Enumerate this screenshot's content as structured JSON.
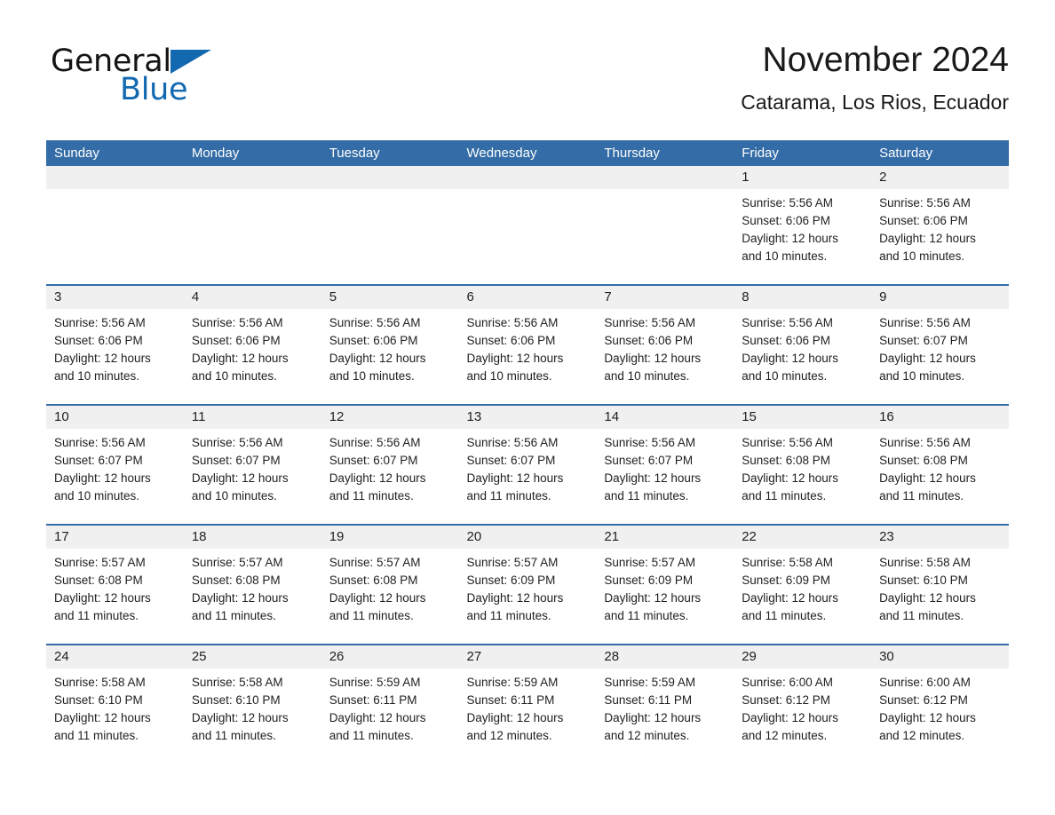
{
  "logo": {
    "word1": "General",
    "word2": "Blue",
    "triangle_color": "#1269b0",
    "text_color": "#141414"
  },
  "header": {
    "month_title": "November 2024",
    "location": "Catarama, Los Rios, Ecuador"
  },
  "colors": {
    "header_blue": "#336ca6",
    "daynum_gray": "#f0f0f0",
    "separator_blue": "#336ca6",
    "text": "#1f1f1f"
  },
  "weekdays": [
    "Sunday",
    "Monday",
    "Tuesday",
    "Wednesday",
    "Thursday",
    "Friday",
    "Saturday"
  ],
  "labels": {
    "sunrise_prefix": "Sunrise:",
    "sunset_prefix": "Sunset:",
    "daylight_prefix": "Daylight:"
  },
  "weeks": [
    [
      {
        "day": "",
        "empty": true
      },
      {
        "day": "",
        "empty": true
      },
      {
        "day": "",
        "empty": true
      },
      {
        "day": "",
        "empty": true
      },
      {
        "day": "",
        "empty": true
      },
      {
        "day": "1",
        "sunrise": "Sunrise: 5:56 AM",
        "sunset": "Sunset: 6:06 PM",
        "daylight_l1": "Daylight: 12 hours",
        "daylight_l2": "and 10 minutes."
      },
      {
        "day": "2",
        "sunrise": "Sunrise: 5:56 AM",
        "sunset": "Sunset: 6:06 PM",
        "daylight_l1": "Daylight: 12 hours",
        "daylight_l2": "and 10 minutes."
      }
    ],
    [
      {
        "day": "3",
        "sunrise": "Sunrise: 5:56 AM",
        "sunset": "Sunset: 6:06 PM",
        "daylight_l1": "Daylight: 12 hours",
        "daylight_l2": "and 10 minutes."
      },
      {
        "day": "4",
        "sunrise": "Sunrise: 5:56 AM",
        "sunset": "Sunset: 6:06 PM",
        "daylight_l1": "Daylight: 12 hours",
        "daylight_l2": "and 10 minutes."
      },
      {
        "day": "5",
        "sunrise": "Sunrise: 5:56 AM",
        "sunset": "Sunset: 6:06 PM",
        "daylight_l1": "Daylight: 12 hours",
        "daylight_l2": "and 10 minutes."
      },
      {
        "day": "6",
        "sunrise": "Sunrise: 5:56 AM",
        "sunset": "Sunset: 6:06 PM",
        "daylight_l1": "Daylight: 12 hours",
        "daylight_l2": "and 10 minutes."
      },
      {
        "day": "7",
        "sunrise": "Sunrise: 5:56 AM",
        "sunset": "Sunset: 6:06 PM",
        "daylight_l1": "Daylight: 12 hours",
        "daylight_l2": "and 10 minutes."
      },
      {
        "day": "8",
        "sunrise": "Sunrise: 5:56 AM",
        "sunset": "Sunset: 6:06 PM",
        "daylight_l1": "Daylight: 12 hours",
        "daylight_l2": "and 10 minutes."
      },
      {
        "day": "9",
        "sunrise": "Sunrise: 5:56 AM",
        "sunset": "Sunset: 6:07 PM",
        "daylight_l1": "Daylight: 12 hours",
        "daylight_l2": "and 10 minutes."
      }
    ],
    [
      {
        "day": "10",
        "sunrise": "Sunrise: 5:56 AM",
        "sunset": "Sunset: 6:07 PM",
        "daylight_l1": "Daylight: 12 hours",
        "daylight_l2": "and 10 minutes."
      },
      {
        "day": "11",
        "sunrise": "Sunrise: 5:56 AM",
        "sunset": "Sunset: 6:07 PM",
        "daylight_l1": "Daylight: 12 hours",
        "daylight_l2": "and 10 minutes."
      },
      {
        "day": "12",
        "sunrise": "Sunrise: 5:56 AM",
        "sunset": "Sunset: 6:07 PM",
        "daylight_l1": "Daylight: 12 hours",
        "daylight_l2": "and 11 minutes."
      },
      {
        "day": "13",
        "sunrise": "Sunrise: 5:56 AM",
        "sunset": "Sunset: 6:07 PM",
        "daylight_l1": "Daylight: 12 hours",
        "daylight_l2": "and 11 minutes."
      },
      {
        "day": "14",
        "sunrise": "Sunrise: 5:56 AM",
        "sunset": "Sunset: 6:07 PM",
        "daylight_l1": "Daylight: 12 hours",
        "daylight_l2": "and 11 minutes."
      },
      {
        "day": "15",
        "sunrise": "Sunrise: 5:56 AM",
        "sunset": "Sunset: 6:08 PM",
        "daylight_l1": "Daylight: 12 hours",
        "daylight_l2": "and 11 minutes."
      },
      {
        "day": "16",
        "sunrise": "Sunrise: 5:56 AM",
        "sunset": "Sunset: 6:08 PM",
        "daylight_l1": "Daylight: 12 hours",
        "daylight_l2": "and 11 minutes."
      }
    ],
    [
      {
        "day": "17",
        "sunrise": "Sunrise: 5:57 AM",
        "sunset": "Sunset: 6:08 PM",
        "daylight_l1": "Daylight: 12 hours",
        "daylight_l2": "and 11 minutes."
      },
      {
        "day": "18",
        "sunrise": "Sunrise: 5:57 AM",
        "sunset": "Sunset: 6:08 PM",
        "daylight_l1": "Daylight: 12 hours",
        "daylight_l2": "and 11 minutes."
      },
      {
        "day": "19",
        "sunrise": "Sunrise: 5:57 AM",
        "sunset": "Sunset: 6:08 PM",
        "daylight_l1": "Daylight: 12 hours",
        "daylight_l2": "and 11 minutes."
      },
      {
        "day": "20",
        "sunrise": "Sunrise: 5:57 AM",
        "sunset": "Sunset: 6:09 PM",
        "daylight_l1": "Daylight: 12 hours",
        "daylight_l2": "and 11 minutes."
      },
      {
        "day": "21",
        "sunrise": "Sunrise: 5:57 AM",
        "sunset": "Sunset: 6:09 PM",
        "daylight_l1": "Daylight: 12 hours",
        "daylight_l2": "and 11 minutes."
      },
      {
        "day": "22",
        "sunrise": "Sunrise: 5:58 AM",
        "sunset": "Sunset: 6:09 PM",
        "daylight_l1": "Daylight: 12 hours",
        "daylight_l2": "and 11 minutes."
      },
      {
        "day": "23",
        "sunrise": "Sunrise: 5:58 AM",
        "sunset": "Sunset: 6:10 PM",
        "daylight_l1": "Daylight: 12 hours",
        "daylight_l2": "and 11 minutes."
      }
    ],
    [
      {
        "day": "24",
        "sunrise": "Sunrise: 5:58 AM",
        "sunset": "Sunset: 6:10 PM",
        "daylight_l1": "Daylight: 12 hours",
        "daylight_l2": "and 11 minutes."
      },
      {
        "day": "25",
        "sunrise": "Sunrise: 5:58 AM",
        "sunset": "Sunset: 6:10 PM",
        "daylight_l1": "Daylight: 12 hours",
        "daylight_l2": "and 11 minutes."
      },
      {
        "day": "26",
        "sunrise": "Sunrise: 5:59 AM",
        "sunset": "Sunset: 6:11 PM",
        "daylight_l1": "Daylight: 12 hours",
        "daylight_l2": "and 11 minutes."
      },
      {
        "day": "27",
        "sunrise": "Sunrise: 5:59 AM",
        "sunset": "Sunset: 6:11 PM",
        "daylight_l1": "Daylight: 12 hours",
        "daylight_l2": "and 12 minutes."
      },
      {
        "day": "28",
        "sunrise": "Sunrise: 5:59 AM",
        "sunset": "Sunset: 6:11 PM",
        "daylight_l1": "Daylight: 12 hours",
        "daylight_l2": "and 12 minutes."
      },
      {
        "day": "29",
        "sunrise": "Sunrise: 6:00 AM",
        "sunset": "Sunset: 6:12 PM",
        "daylight_l1": "Daylight: 12 hours",
        "daylight_l2": "and 12 minutes."
      },
      {
        "day": "30",
        "sunrise": "Sunrise: 6:00 AM",
        "sunset": "Sunset: 6:12 PM",
        "daylight_l1": "Daylight: 12 hours",
        "daylight_l2": "and 12 minutes."
      }
    ]
  ]
}
